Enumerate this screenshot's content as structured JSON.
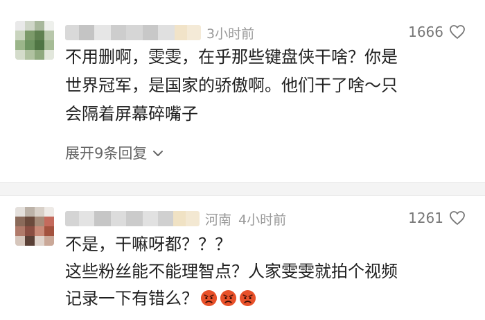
{
  "comments": [
    {
      "time": "3小时前",
      "location": "",
      "likes": "1666",
      "lines": [
        "不用删啊，雯雯，在乎那些键盘侠干啥？你是",
        "世界冠军，是国家的骄傲啊。他们干了啥～只",
        "会隔着屏幕碎嘴子"
      ],
      "expand_label": "展开9条回复",
      "icons": {
        "like": "heart-outline-icon",
        "expand": "chevron-down-icon"
      }
    },
    {
      "time": "4小时前",
      "location": "河南",
      "likes": "1261",
      "lines": [
        "不是，干嘛呀都？？？",
        "这些粉丝能不能理智点？人家雯雯就拍个视频",
        "记录一下有错么？"
      ],
      "emoji": [
        "angry-face-icon",
        "angry-face-icon",
        "angry-face-icon"
      ],
      "icons": {
        "like": "heart-outline-icon"
      }
    }
  ],
  "colors": {
    "text": "#1f1f1f",
    "meta": "#9a9a9a",
    "likes": "#777777",
    "divider": "#f4f4f4",
    "angry": "#e8512a"
  }
}
